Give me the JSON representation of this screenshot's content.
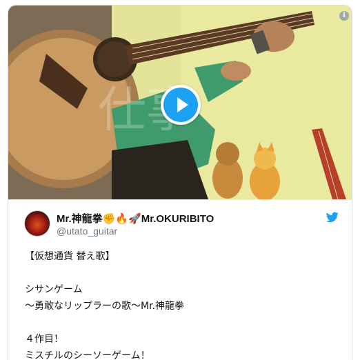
{
  "tweet": {
    "display_name": "Mr.神龍拳✊🔥🚀Mr.OKURIBITO",
    "handle": "@utato_guitar",
    "text": "【仮想通貨 替え歌】\n\nシサンゲーム\n〜勇敢なリップラーの歌〜Mr.神龍拳\n\n４作目！\nミスチルのシーソーゲーム！",
    "video_watermark": "仕事"
  },
  "icons": {
    "info": "info-icon",
    "play": "play-icon",
    "bird": "twitter-bird-icon"
  },
  "colors": {
    "accent": "#1da1f2",
    "border": "#d9dde1",
    "secondary_text": "#657786"
  }
}
